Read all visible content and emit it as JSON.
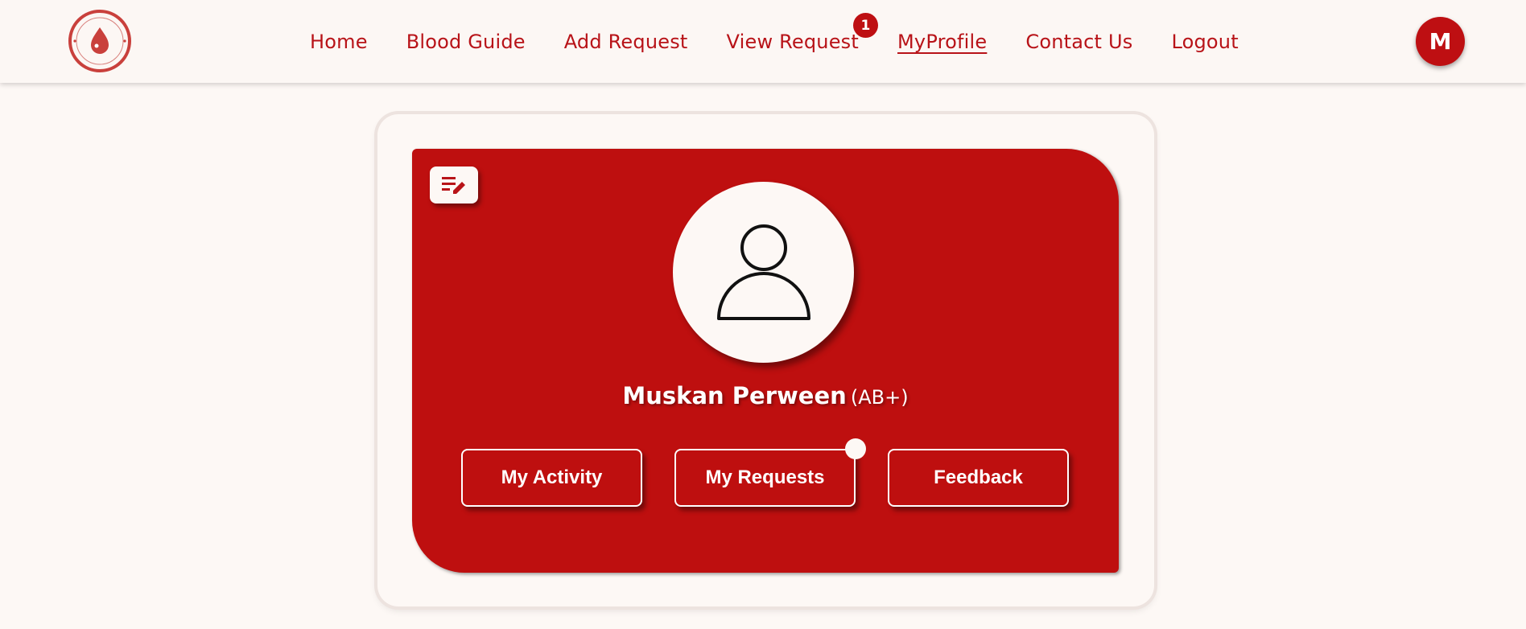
{
  "nav": {
    "logo_top_text": "DONATE BLOOD",
    "logo_bottom_text": "SAVE LIFE",
    "links": [
      {
        "label": "Home"
      },
      {
        "label": "Blood Guide"
      },
      {
        "label": "Add Request"
      },
      {
        "label": "View Request",
        "badge": "1"
      },
      {
        "label": "MyProfile",
        "active": true
      },
      {
        "label": "Contact Us"
      },
      {
        "label": "Logout"
      }
    ],
    "avatar_initial": "M"
  },
  "profile": {
    "name": "Muskan Perween",
    "blood_group": "(AB+)",
    "edit_icon": "edit-note-icon",
    "avatar_icon": "user-icon",
    "buttons": {
      "activity": "My Activity",
      "requests": "My Requests",
      "feedback": "Feedback"
    }
  },
  "colors": {
    "brand": "#be0f0f",
    "background": "#fdf8f5",
    "link": "#b81318"
  }
}
